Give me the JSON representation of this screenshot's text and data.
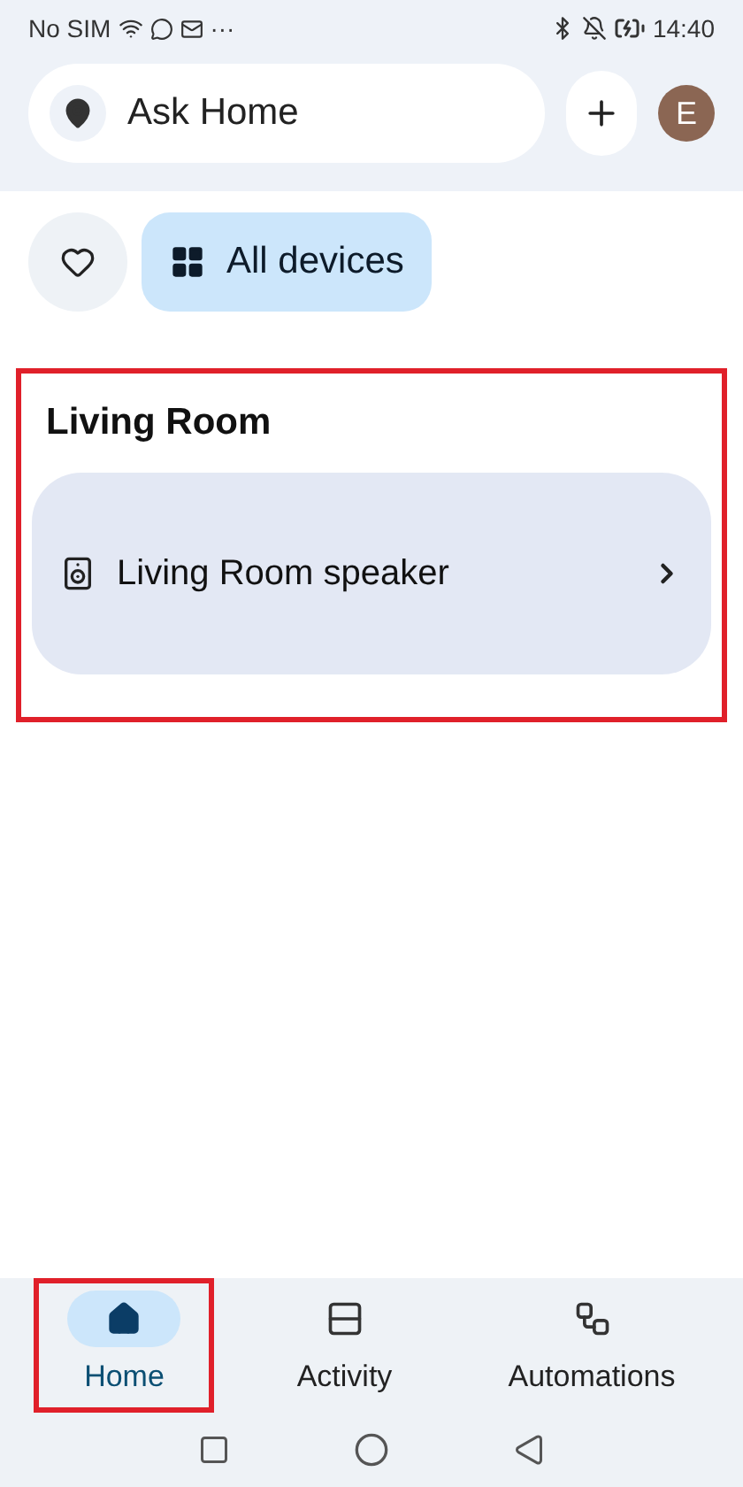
{
  "status_bar": {
    "carrier": "No SIM",
    "overflow": "···",
    "time": "14:40"
  },
  "header": {
    "search": {
      "placeholder": "Ask Home"
    },
    "avatar": "E"
  },
  "filters": [
    {
      "kind": "favorites",
      "selected": false
    },
    {
      "kind": "all",
      "label": "All devices",
      "selected": true
    }
  ],
  "rooms": [
    {
      "title": "Living Room",
      "highlighted": true,
      "devices": [
        {
          "name": "Living Room speaker"
        }
      ]
    }
  ],
  "nav": [
    {
      "label": "Home",
      "kind": "home",
      "selected": true,
      "highlighted": true
    },
    {
      "label": "Activity",
      "kind": "activity",
      "selected": false,
      "highlighted": false
    },
    {
      "label": "Automations",
      "kind": "automations",
      "selected": false,
      "highlighted": false
    }
  ]
}
